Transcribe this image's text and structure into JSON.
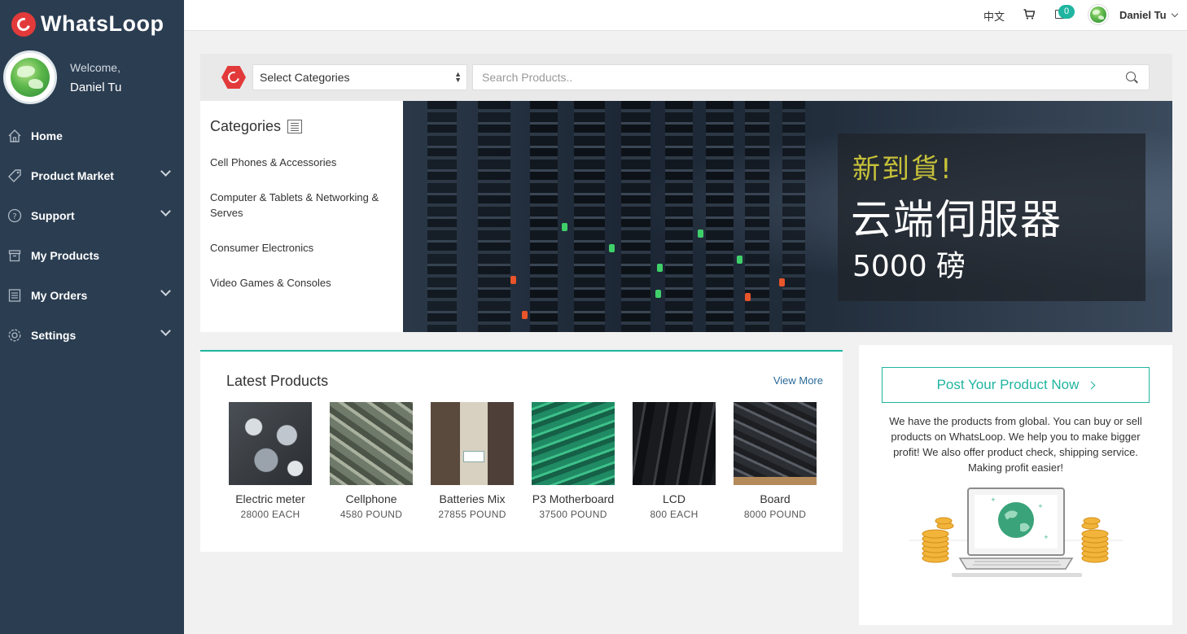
{
  "app": {
    "name": "WhatsLoop"
  },
  "profile": {
    "welcome": "Welcome,",
    "name": "Daniel Tu"
  },
  "sidebar": {
    "items": [
      {
        "label": "Home",
        "icon": "home-icon",
        "expandable": false
      },
      {
        "label": "Product Market",
        "icon": "tag-icon",
        "expandable": true
      },
      {
        "label": "Support",
        "icon": "help-icon",
        "expandable": true
      },
      {
        "label": "My Products",
        "icon": "box-icon",
        "expandable": false
      },
      {
        "label": "My Orders",
        "icon": "list-icon",
        "expandable": true
      },
      {
        "label": "Settings",
        "icon": "gear-icon",
        "expandable": true
      }
    ]
  },
  "topbar": {
    "language": "中文",
    "cart_icon": "cart-icon",
    "mail_icon": "mail-icon",
    "mail_count": "0",
    "user_name": "Daniel Tu"
  },
  "search": {
    "category_value": "Select Categories",
    "placeholder": "Search Products.."
  },
  "categories": {
    "title": "Categories",
    "items": [
      "Cell Phones & Accessories",
      "Computer & Tablets & Networking & Serves",
      "Consumer Electronics",
      "Video Games & Consoles"
    ]
  },
  "banner": {
    "line1": "新到貨!",
    "line2": "云端伺服器",
    "line3": "5000 磅"
  },
  "latest": {
    "title": "Latest Products",
    "view_more": "View More",
    "products": [
      {
        "name": "Electric meter",
        "price": "28000 EACH"
      },
      {
        "name": "Cellphone",
        "price": "4580 POUND"
      },
      {
        "name": "Batteries Mix",
        "price": "27855 POUND"
      },
      {
        "name": "P3 Motherboard",
        "price": "37500 POUND"
      },
      {
        "name": "LCD",
        "price": "800 EACH"
      },
      {
        "name": "Board",
        "price": "8000 POUND"
      }
    ]
  },
  "post": {
    "button_label": "Post Your Product Now",
    "description": "We have the products from global. You can buy or sell products on WhatsLoop. We help you to make bigger profit! We also offer product check, shipping service. Making profit easier!"
  },
  "colors": {
    "sidebar": "#2b3d51",
    "accent": "#1fb5a0",
    "brand": "#e23a3a"
  }
}
